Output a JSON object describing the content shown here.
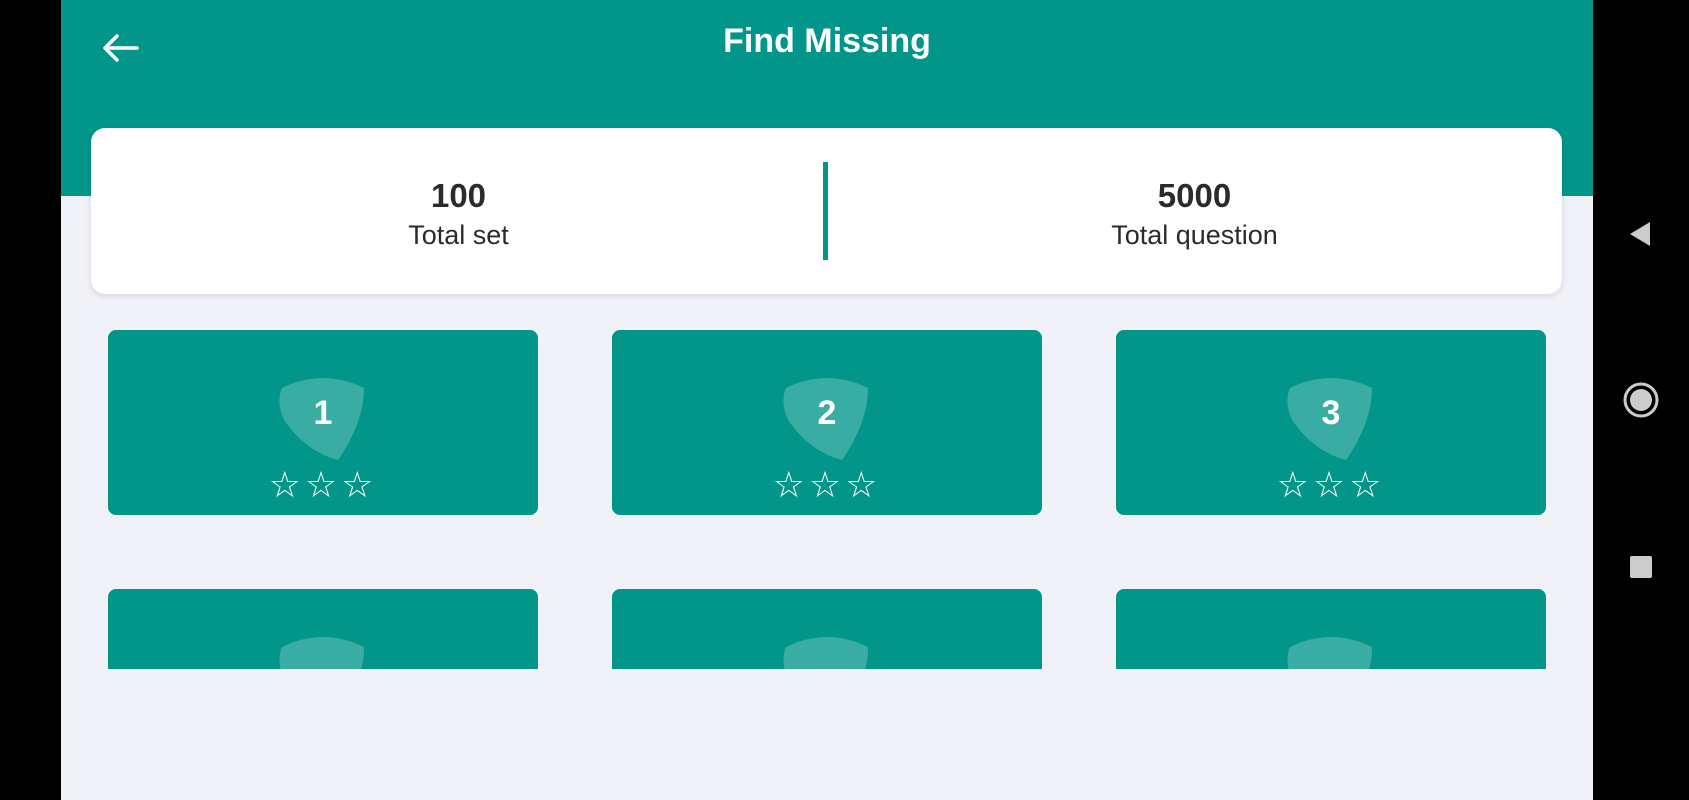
{
  "app": {
    "title": "Find Missing"
  },
  "stats": {
    "total_set_value": "100",
    "total_set_label": "Total set",
    "total_question_value": "5000",
    "total_question_label": "Total question"
  },
  "sets": [
    {
      "number": "1",
      "stars": 0,
      "max_stars": 3
    },
    {
      "number": "2",
      "stars": 0,
      "max_stars": 3
    },
    {
      "number": "3",
      "stars": 0,
      "max_stars": 3
    }
  ],
  "icons": {
    "back": "arrow-left-icon",
    "more": "more-vert-icon",
    "star": "star-outline-icon",
    "nav_back": "triangle-back-icon",
    "nav_home": "circle-home-icon",
    "nav_recents": "square-recents-icon"
  },
  "colors": {
    "primary": "#02968a",
    "background": "#f0f2f7",
    "card": "#ffffff",
    "text": "#2b2b2b"
  }
}
